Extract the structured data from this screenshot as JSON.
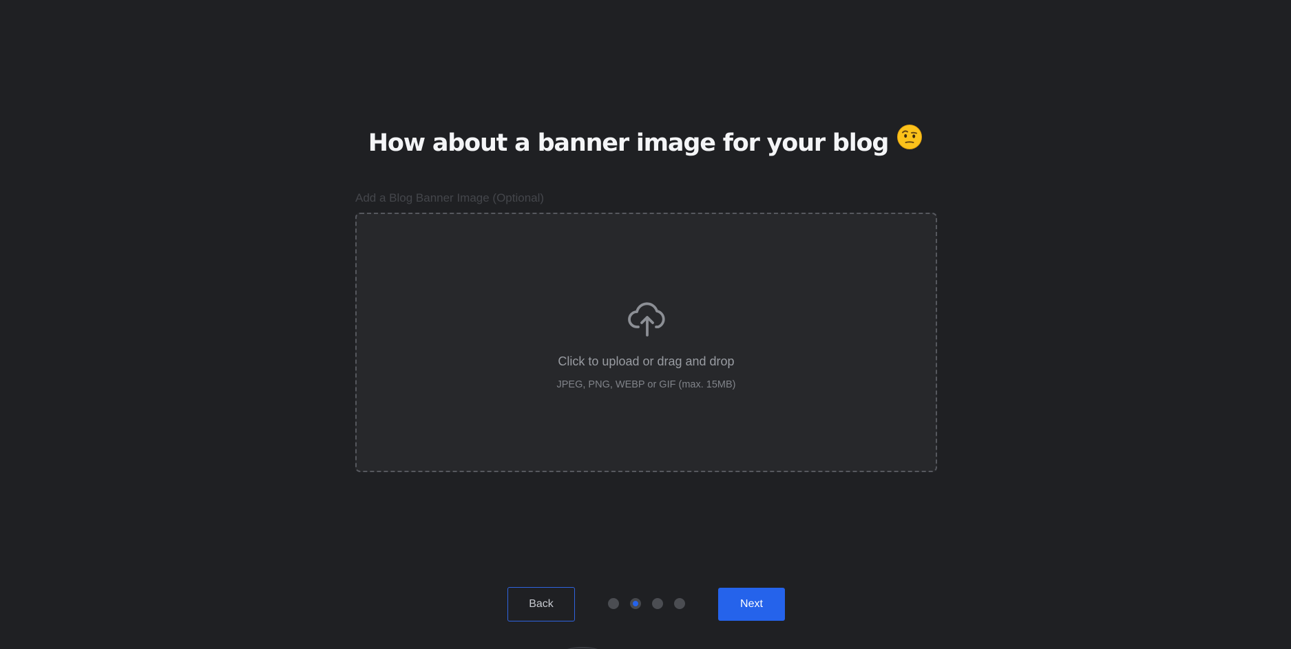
{
  "page": {
    "title": "How about a banner image for your blog",
    "title_emoji_name": "raised-eyebrow-emoji"
  },
  "field": {
    "label": "Add a Blog Banner Image (Optional)"
  },
  "dropzone": {
    "icon": "cloud-upload-icon",
    "main_text": "Click to upload or drag and drop",
    "hint_text": "JPEG, PNG, WEBP or GIF (max. 15MB)"
  },
  "navigation": {
    "back_label": "Back",
    "next_label": "Next",
    "steps_total": 4,
    "current_step": 2
  },
  "colors": {
    "background": "#1f2023",
    "accent": "#2563eb",
    "dropzone_bg": "#27282b"
  }
}
